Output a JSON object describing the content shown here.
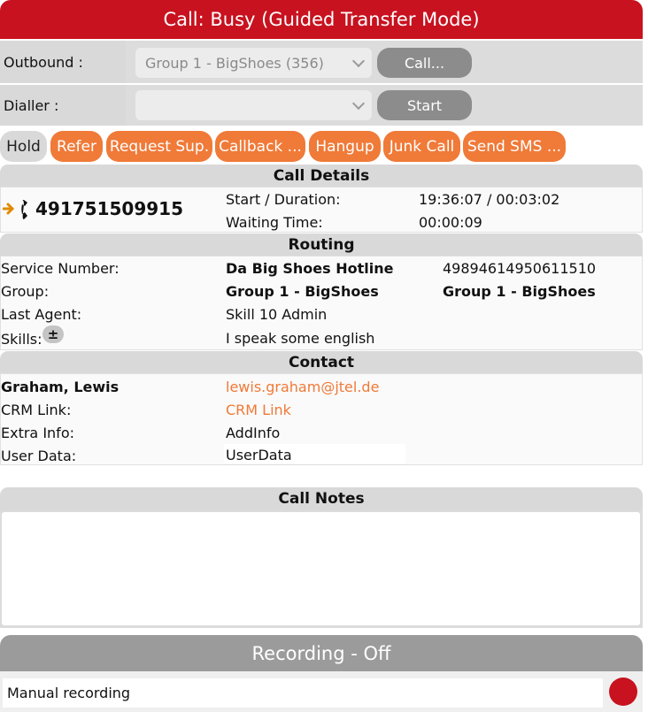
{
  "header": {
    "title": "Call: Busy (Guided Transfer Mode)"
  },
  "outbound": {
    "label": "Outbound :",
    "select_value": "Group 1 - BigShoes (356)",
    "call_button": "Call..."
  },
  "dialler": {
    "label": "Dialler :",
    "select_value": "",
    "start_button": "Start"
  },
  "actions": {
    "hold": "Hold",
    "refer": "Refer",
    "request_sup": "Request Sup.",
    "callback": "Callback ...",
    "hangup": "Hangup",
    "junk_call": "Junk Call",
    "send_sms": "Send SMS ..."
  },
  "call_details": {
    "title": "Call Details",
    "number": "491751509915",
    "start_label": "Start / Duration:",
    "start_value": "19:36:07 / 00:03:02",
    "waiting_label": "Waiting Time:",
    "waiting_value": "00:00:09"
  },
  "routing": {
    "title": "Routing",
    "service_number_label": "Service Number:",
    "service_number_name": "Da Big Shoes Hotline",
    "service_number_value": "49894614950611510",
    "group_label": "Group:",
    "group_name": "Group 1 - BigShoes",
    "group_value": "Group 1 - BigShoes",
    "last_agent_label": "Last Agent:",
    "last_agent_value": "Skill 10 Admin",
    "skills_label": "Skills:",
    "skills_toggle": "±",
    "skills_value": "I speak some english"
  },
  "contact": {
    "title": "Contact",
    "name": "Graham, Lewis",
    "email": "lewis.graham@jtel.de",
    "crm_label": "CRM Link:",
    "crm_value": "CRM Link",
    "extra_label": "Extra Info:",
    "extra_value": "AddInfo",
    "userdata_label": "User Data:",
    "userdata_value": "UserData"
  },
  "call_notes": {
    "title": "Call Notes",
    "value": ""
  },
  "recording": {
    "title": "Recording - Off",
    "manual_label": "Manual recording"
  },
  "colors": {
    "header_red": "#c8121f",
    "action_orange": "#f07a38",
    "record_red": "#c8121f",
    "disabled_grey": "#8c8c8c"
  }
}
